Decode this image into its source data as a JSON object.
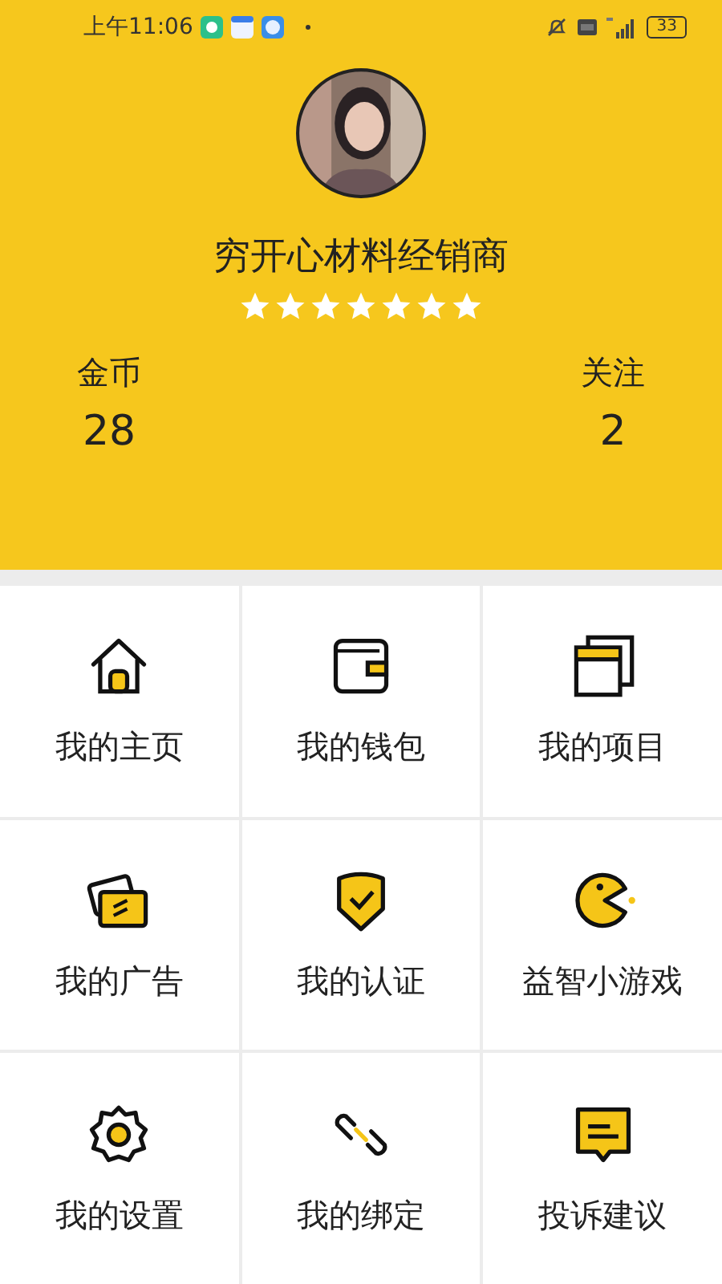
{
  "status_bar": {
    "time": "上午11:06",
    "battery": "33"
  },
  "profile": {
    "name": "穷开心材料经销商",
    "stars": 7
  },
  "stats": [
    {
      "label": "金币",
      "value": "28"
    },
    {
      "label": "关注",
      "value": "2"
    }
  ],
  "menu": [
    {
      "label": "我的主页"
    },
    {
      "label": "我的钱包"
    },
    {
      "label": "我的项目"
    },
    {
      "label": "我的广告"
    },
    {
      "label": "我的认证"
    },
    {
      "label": "益智小游戏"
    },
    {
      "label": "我的设置"
    },
    {
      "label": "我的绑定"
    },
    {
      "label": "投诉建议"
    }
  ]
}
